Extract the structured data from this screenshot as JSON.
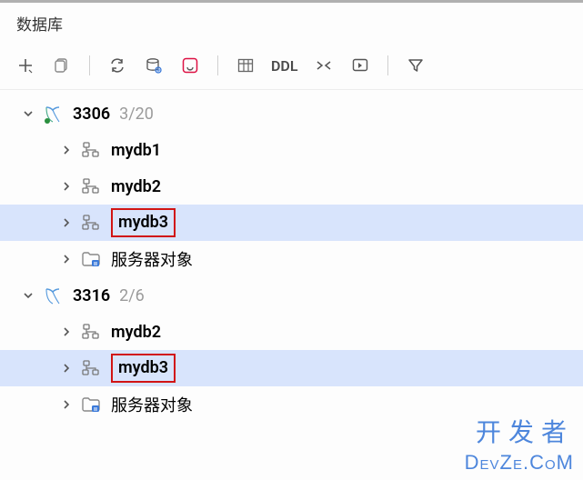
{
  "panel": {
    "title": "数据库"
  },
  "toolbar": {
    "add_label": "+",
    "ddl_label": "DDL"
  },
  "connections": [
    {
      "name": "3306",
      "count": "3/20",
      "expanded": true,
      "children": [
        {
          "type": "schema",
          "name": "mydb1",
          "expanded": false,
          "selected": false,
          "highlighted": false
        },
        {
          "type": "schema",
          "name": "mydb2",
          "expanded": false,
          "selected": false,
          "highlighted": false
        },
        {
          "type": "schema",
          "name": "mydb3",
          "expanded": false,
          "selected": true,
          "highlighted": true
        },
        {
          "type": "server_objects",
          "name": "服务器对象",
          "expanded": false,
          "selected": false,
          "highlighted": false
        }
      ]
    },
    {
      "name": "3316",
      "count": "2/6",
      "expanded": true,
      "children": [
        {
          "type": "schema",
          "name": "mydb2",
          "expanded": false,
          "selected": false,
          "highlighted": false
        },
        {
          "type": "schema",
          "name": "mydb3",
          "expanded": false,
          "selected": true,
          "highlighted": true
        },
        {
          "type": "server_objects",
          "name": "服务器对象",
          "expanded": false,
          "selected": false,
          "highlighted": false
        }
      ]
    }
  ],
  "watermark": {
    "cn": "开发者",
    "en": "DevZe.CoM"
  }
}
